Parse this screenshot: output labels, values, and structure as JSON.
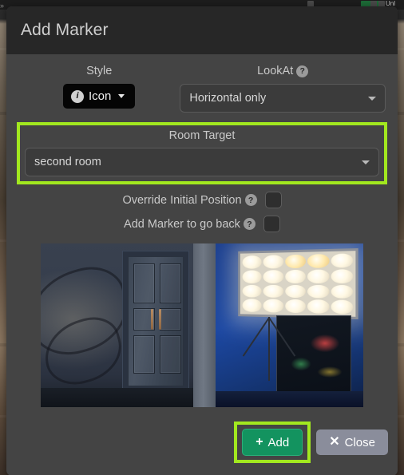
{
  "background": {
    "topbar_label": "Unl",
    "corner_glyph": "»"
  },
  "modal": {
    "title": "Add Marker",
    "style": {
      "label": "Style",
      "button_label": "Icon",
      "info_glyph": "i",
      "caret_icon": "caret-down-icon"
    },
    "lookat": {
      "label": "LookAt",
      "help_glyph": "?",
      "value": "Horizontal only",
      "options": [
        "Horizontal only"
      ]
    },
    "room_target": {
      "label": "Room Target",
      "value": "second room",
      "options": [
        "second room"
      ],
      "highlight_color": "#a2e81f"
    },
    "checkboxes": [
      {
        "label": "Override Initial Position",
        "help_glyph": "?",
        "checked": false
      },
      {
        "label": "Add Marker to go back",
        "help_glyph": "?",
        "checked": false
      }
    ],
    "preview": {
      "alt": "360 panorama preview of a blue room with a wooden double door and a studio light panel"
    },
    "footer": {
      "add_label": "Add",
      "add_icon": "plus-icon",
      "add_color": "#13935f",
      "add_highlight_color": "#a2e81f",
      "close_label": "Close",
      "close_icon": "close-x-icon",
      "close_color": "#8a8d9b"
    }
  }
}
